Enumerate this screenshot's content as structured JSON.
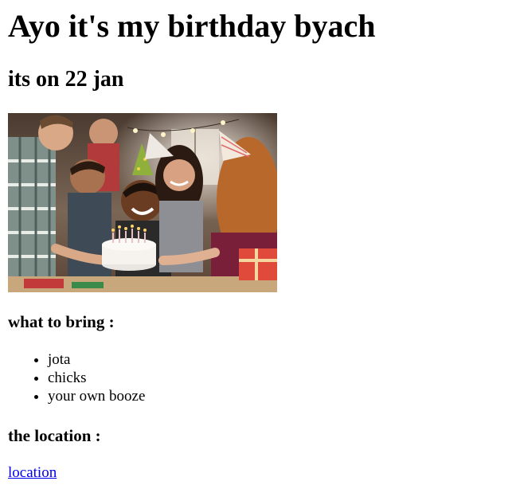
{
  "header": {
    "title": "Ayo it's my birthday byach",
    "subtitle": "its on 22 jan"
  },
  "image": {
    "subject": "birthday party photo with friends in party hats around a cake with candles"
  },
  "bring_section": {
    "heading": "what to bring :",
    "items": [
      "jota",
      "chicks",
      "your own booze"
    ]
  },
  "location_section": {
    "heading": "the location :",
    "link_text": "location"
  },
  "colors": {
    "link": "#0000ee",
    "text": "#000000",
    "background": "#ffffff"
  }
}
